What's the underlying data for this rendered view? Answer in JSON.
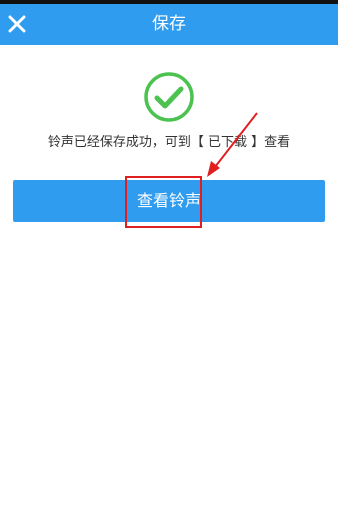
{
  "header": {
    "title": "保存",
    "close_icon": "close-icon",
    "background": "#2f9cf0"
  },
  "content": {
    "success_icon": "check-circle-icon",
    "success_color": "#4cc250",
    "message": "铃声已经保存成功，可到【 已下载 】查看"
  },
  "primary_button": {
    "label": "查看铃声",
    "color": "#2f9cf0"
  },
  "annotation": {
    "color": "#e02020"
  }
}
